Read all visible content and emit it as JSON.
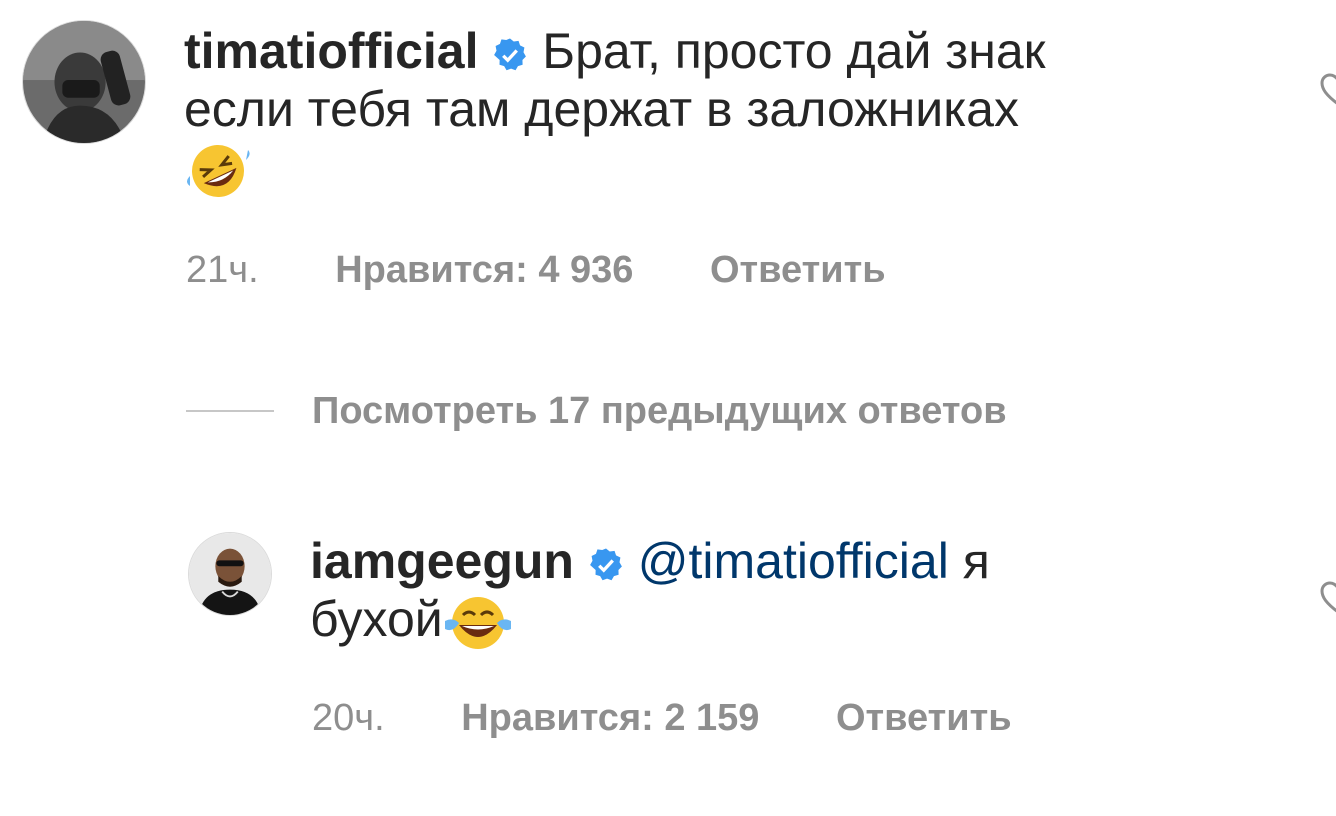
{
  "comments": [
    {
      "username": "timatiofficial",
      "verified": true,
      "text_line1": "Брат, просто дай знак",
      "text_line2": "если тебя там держат в заложниках",
      "emoji": "rolling-on-floor-laughing",
      "time": "21ч.",
      "likes": "Нравится: 4 936",
      "reply_label": "Ответить"
    },
    {
      "username": "iamgeegun",
      "verified": true,
      "mention": "@timatiofficial",
      "text_after_mention": "я",
      "text_line2": "бухой",
      "emoji": "face-with-tears-of-joy",
      "time": "20ч.",
      "likes": "Нравится: 2 159",
      "reply_label": "Ответить"
    }
  ],
  "view_replies_label": "Посмотреть 17 предыдущих ответов",
  "colors": {
    "text": "#262626",
    "secondary": "#8e8e8e",
    "mention": "#00376b",
    "verified": "#3897f0"
  }
}
